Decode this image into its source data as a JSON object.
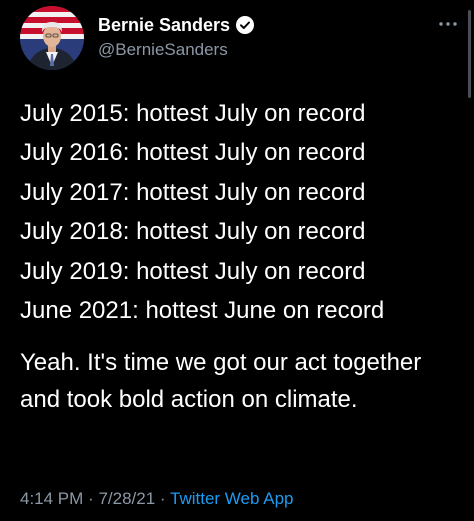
{
  "author": {
    "display_name": "Bernie Sanders",
    "handle": "@BernieSanders",
    "verified": true,
    "avatar_icon": "profile-photo-with-flag"
  },
  "tweet": {
    "lines": [
      "July 2015: hottest July on record",
      "July 2016: hottest July on record",
      "July 2017: hottest July on record",
      "July 2018: hottest July on record",
      "July 2019: hottest July on record",
      "June 2021: hottest June on record"
    ],
    "paragraph": "Yeah. It's time we got our act together and took bold action on climate."
  },
  "meta": {
    "time": "4:14 PM",
    "separator": "·",
    "date": "7/28/21",
    "source": "Twitter Web App"
  },
  "colors": {
    "background": "#000000",
    "text": "#ffffff",
    "muted": "#8b98a5",
    "accent": "#1d9bf0"
  }
}
